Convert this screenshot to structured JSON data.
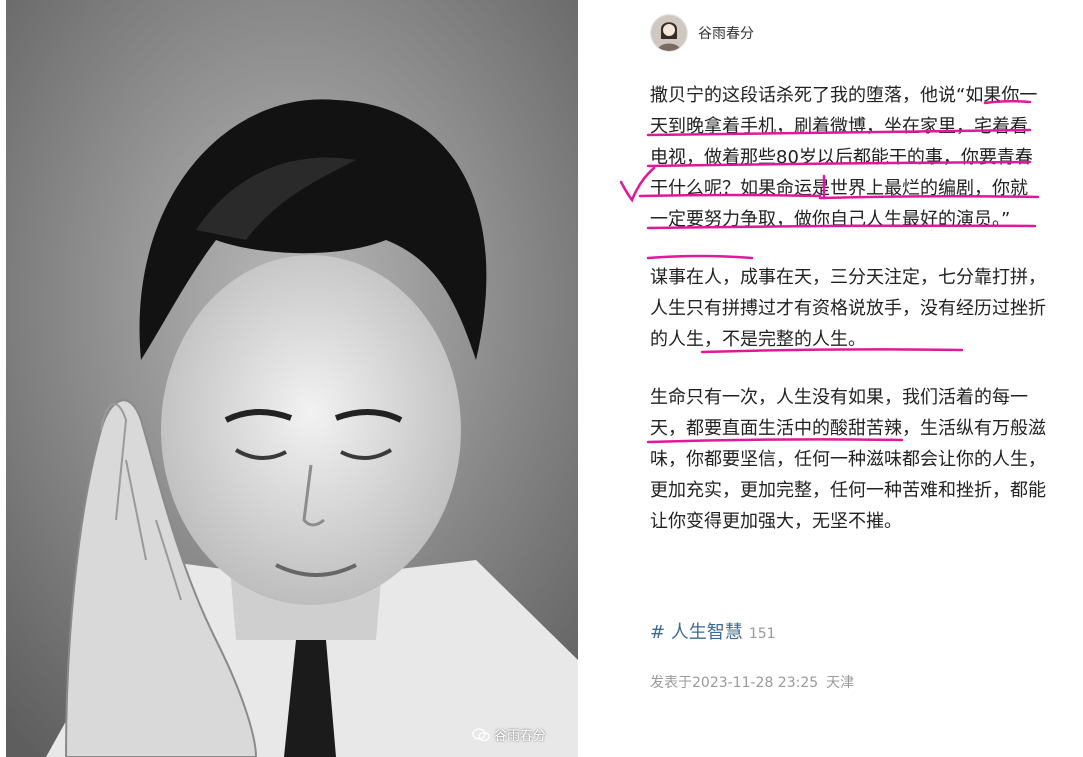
{
  "photo": {
    "watermark_text": "谷雨春分",
    "watermark_icon": "wechat-icon"
  },
  "author": {
    "name": "谷雨春分",
    "avatar_icon": "avatar"
  },
  "post": {
    "paragraphs": [
      "撒贝宁的这段话杀死了我的堕落，他说“如果你一天到晚拿着手机，刷着微博，坐在家里，宅着看电视，做着那些80岁以后都能干的事，你要青春干什么呢？如果命运是世界上最烂的编剧，你就一定要努力争取，做你自己人生最好的演员。”",
      "谋事在人，成事在天，三分天注定，七分靠打拼，人生只有拼搏过才有资格说放手，没有经历过挫折的人生，不是完整的人生。",
      "生命只有一次，人生没有如果，我们活着的每一天，都要直面生活中的酸甜苦辣，生活纵有万般滋味，你都要坚信，任何一种滋味都会让你的人生，更加充实，更加完整，任何一种苦难和挫折，都能让你变得更加强大，无坚不摧。"
    ]
  },
  "hashtag": {
    "label": "# 人生智慧",
    "count": "151"
  },
  "meta": {
    "posted": "发表于2023-11-28 23:25",
    "location": "天津"
  },
  "colors": {
    "annotation": "#e0189a",
    "link": "#3d6b96",
    "meta": "#9a9a9a"
  }
}
